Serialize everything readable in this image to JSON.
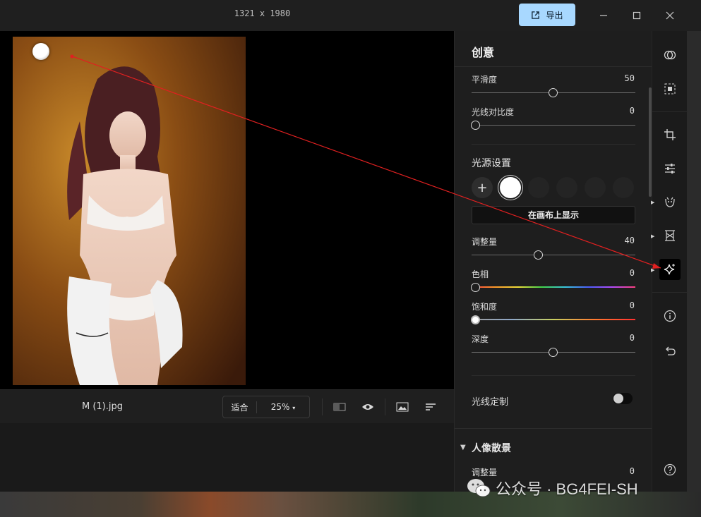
{
  "titlebar": {
    "image_dimensions": "1321 x 1980",
    "export_label": "导出"
  },
  "canvas": {
    "filename": "M (1).jpg",
    "fit_label": "适合",
    "zoom_label": "25%"
  },
  "panel": {
    "title": "创意",
    "smoothness": {
      "label": "平滑度",
      "value": "50",
      "level": 50
    },
    "light_contrast": {
      "label": "光线对比度",
      "value": "0",
      "level": 0
    },
    "light_source": {
      "section_title": "光源设置",
      "add_label": "+",
      "show_on_canvas": "在画布上显示"
    },
    "amount": {
      "label": "调整量",
      "value": "40",
      "level": 40
    },
    "hue": {
      "label": "色相",
      "value": "0",
      "level": 0
    },
    "saturation": {
      "label": "饱和度",
      "value": "0",
      "level": 0
    },
    "depth": {
      "label": "深度",
      "value": "0",
      "level": 50
    },
    "light_custom": {
      "label": "光线定制",
      "enabled": false
    },
    "portrait_bokeh": {
      "section_title": "人像散景",
      "amount": {
        "label": "调整量",
        "value": "0"
      }
    }
  },
  "watermark": {
    "text": "公众号 · BG4FEI-SH"
  },
  "colors": {
    "accent": "#a8d8ff",
    "arrow": "#e02020",
    "panel_bg": "#1e1e1e",
    "canvas_bg": "#000000"
  },
  "icons": {
    "export": "export-icon",
    "minimize": "minimize-icon",
    "maximize": "maximize-icon",
    "close": "close-icon",
    "rail": [
      "overlap-circles-icon",
      "select-frame-icon",
      "crop-icon",
      "sliders-icon",
      "face-icon",
      "texture-icon",
      "sparkle-icon",
      "info-icon",
      "undo-icon"
    ]
  }
}
